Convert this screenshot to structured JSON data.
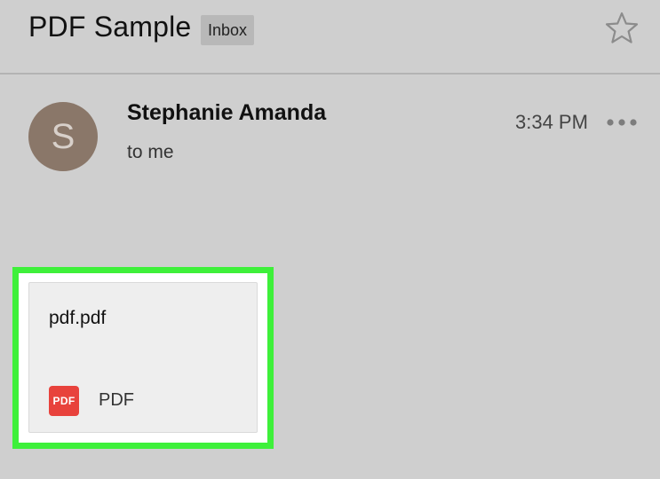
{
  "header": {
    "subject": "PDF Sample",
    "label": "Inbox",
    "star_icon": "star-outline-icon"
  },
  "message": {
    "avatar_letter": "S",
    "avatar_color": "#8a7769",
    "sender": "Stephanie Amanda",
    "recipient": "to me",
    "time": "3:34 PM",
    "more_icon": "more-horizontal-icon"
  },
  "attachment": {
    "filename": "pdf.pdf",
    "icon_label": "PDF",
    "type_label": "PDF",
    "icon_color": "#e8423c",
    "highlight_color": "#3ef03a"
  }
}
